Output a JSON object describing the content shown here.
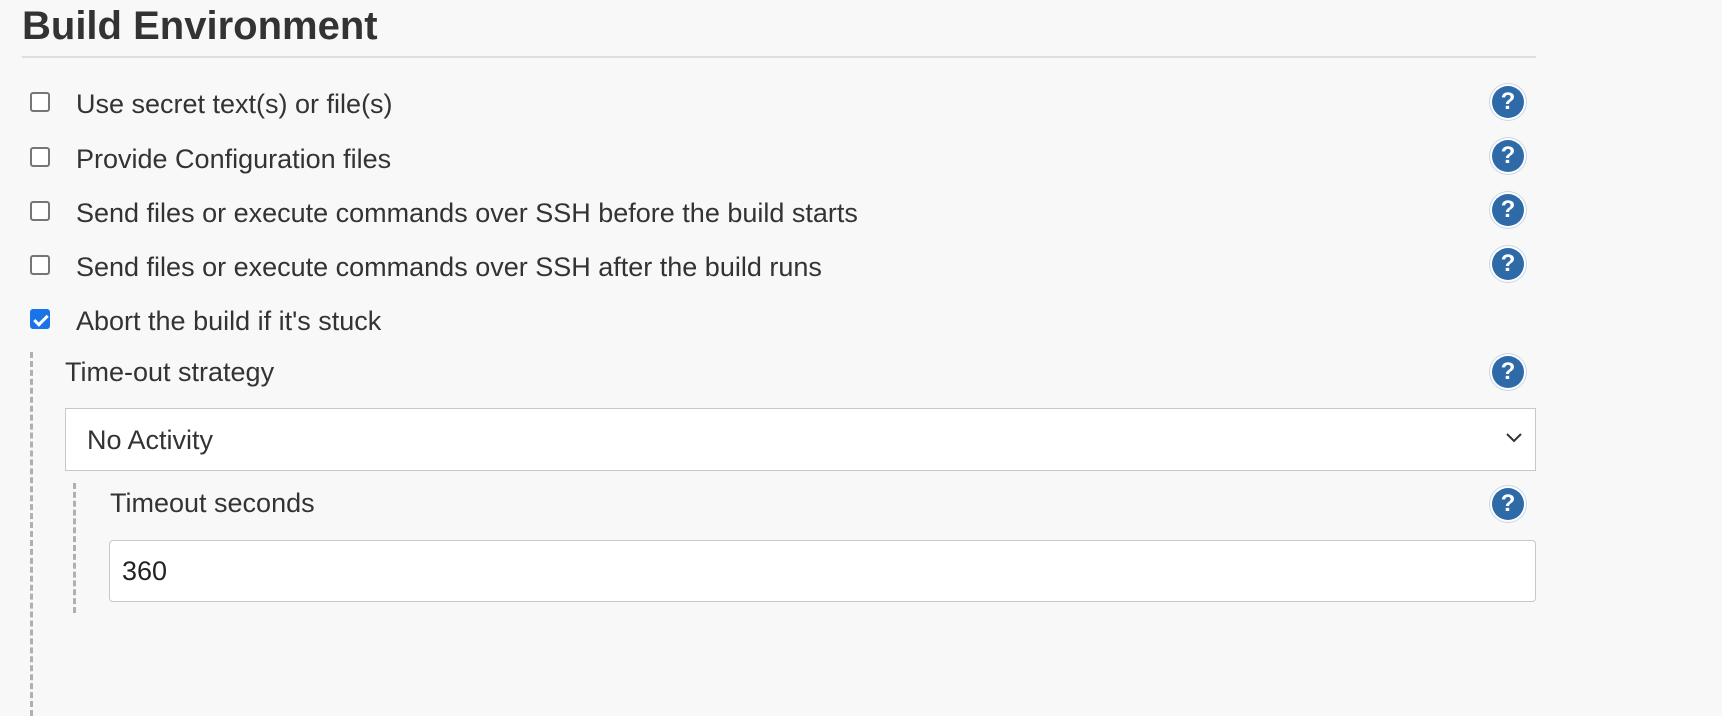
{
  "section": {
    "title": "Build Environment"
  },
  "options": [
    {
      "label": "Use secret text(s) or file(s)",
      "checked": false
    },
    {
      "label": "Provide Configuration files",
      "checked": false
    },
    {
      "label": "Send files or execute commands over SSH before the build starts",
      "checked": false
    },
    {
      "label": "Send files or execute commands over SSH after the build runs",
      "checked": false
    },
    {
      "label": "Abort the build if it's stuck",
      "checked": true
    }
  ],
  "timeout_strategy": {
    "label": "Time-out strategy",
    "selected": "No Activity"
  },
  "timeout_seconds": {
    "label": "Timeout seconds",
    "value": "360"
  },
  "help_icon": {
    "symbol": "?",
    "icon": "help-icon"
  },
  "colors": {
    "help_icon": "#2e6aa8",
    "checkbox_checked": "#1a73e8",
    "background": "#f8f8f8"
  }
}
